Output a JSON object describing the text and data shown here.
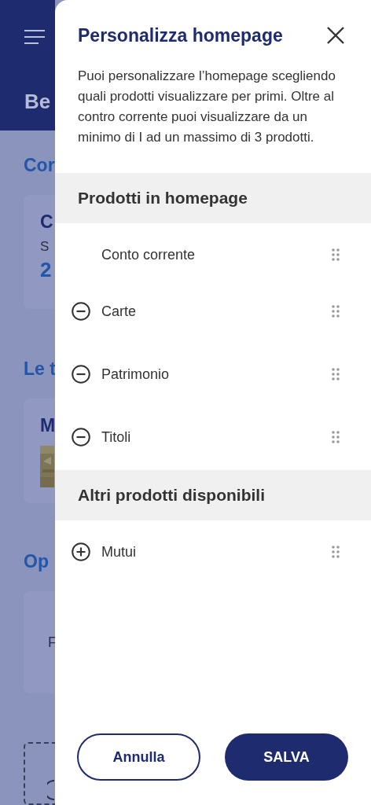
{
  "background": {
    "title": "Be",
    "section_1": "Cor",
    "card_1_title": "C",
    "card_1_label": "S",
    "card_1_value": "2",
    "section_2": "Le t",
    "card_2_title": "M",
    "section_3": "Op",
    "card_3_text": "F"
  },
  "panel": {
    "title": "Personalizza homepage",
    "description": "Puoi personalizzare l’homepage scegliendo quali prodotti visualizzare per primi. Oltre al contro corrente puoi visualizzare da un minimo di I ad un massimo di 3 prodotti.",
    "sections": [
      {
        "title": "Prodotti in homepage",
        "items": [
          {
            "label": "Conto corrente",
            "kind": "fixed"
          },
          {
            "label": "Carte",
            "kind": "remove"
          },
          {
            "label": "Patrimonio",
            "kind": "remove"
          },
          {
            "label": "Titoli",
            "kind": "remove"
          }
        ]
      },
      {
        "title": "Altri prodotti disponibili",
        "items": [
          {
            "label": "Mutui",
            "kind": "add"
          }
        ]
      }
    ],
    "buttons": [
      {
        "label": "Annulla",
        "kind": "secondary"
      },
      {
        "label": "SALVA",
        "kind": "primary"
      }
    ]
  }
}
